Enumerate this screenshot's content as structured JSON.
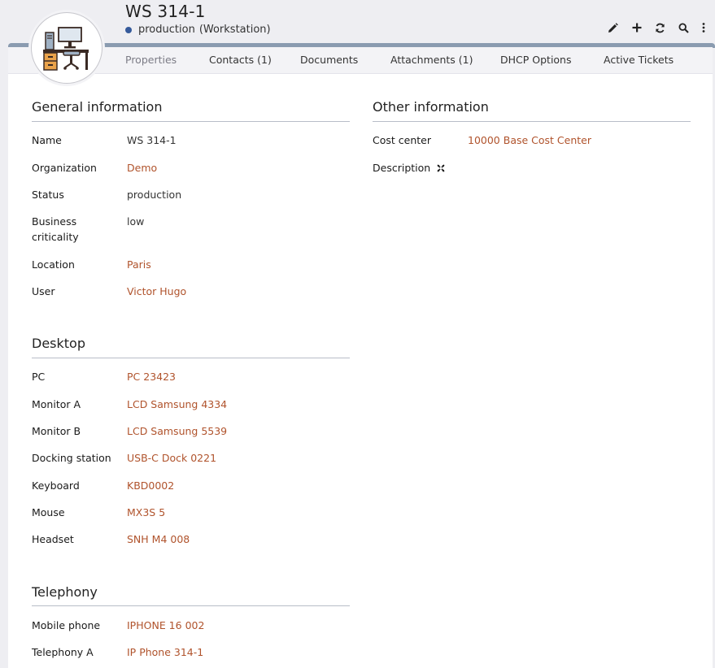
{
  "header": {
    "title": "WS 314-1",
    "status": "production",
    "class": "(Workstation)"
  },
  "toolbar": {
    "icons": [
      "pencil-icon",
      "plus-icon",
      "refresh-icon",
      "search-icon",
      "more-vertical-icon"
    ]
  },
  "tabs": [
    {
      "label": "Properties"
    },
    {
      "label": "Contacts (1)"
    },
    {
      "label": "Documents"
    },
    {
      "label": "Attachments (1)"
    },
    {
      "label": "DHCP Options"
    },
    {
      "label": "Active Tickets"
    }
  ],
  "general": {
    "title": "General information",
    "name_label": "Name",
    "name_value": "WS 314-1",
    "org_label": "Organization",
    "org_value": "Demo",
    "status_label": "Status",
    "status_value": "production",
    "crit_label_1": "Business",
    "crit_label_2": "criticality",
    "crit_value": "low",
    "location_label": "Location",
    "location_value": "Paris",
    "user_label": "User",
    "user_value": "Victor Hugo"
  },
  "desktop": {
    "title": "Desktop",
    "pc_label": "PC",
    "pc_value": "PC 23423",
    "monA_label": "Monitor A",
    "monA_value": "LCD Samsung 4334",
    "monB_label": "Monitor B",
    "monB_value": "LCD Samsung 5539",
    "dock_label": "Docking station",
    "dock_value": "USB-C Dock 0221",
    "kbd_label": "Keyboard",
    "kbd_value": "KBD0002",
    "mouse_label": "Mouse",
    "mouse_value": "MX3S 5",
    "headset_label": "Headset",
    "headset_value": "SNH M4 008"
  },
  "telephony": {
    "title": "Telephony",
    "mobile_label": "Mobile phone",
    "mobile_value": "IPHONE 16 002",
    "telA_label": "Telephony A",
    "telA_value": "IP Phone 314-1"
  },
  "other": {
    "title": "Other information",
    "cost_label": "Cost center",
    "cost_value": "10000 Base Cost Center",
    "desc_label": "Description"
  },
  "colors": {
    "link": "#b0532c",
    "status_dot": "#355a9b",
    "stripe": "#8a9bb0"
  }
}
